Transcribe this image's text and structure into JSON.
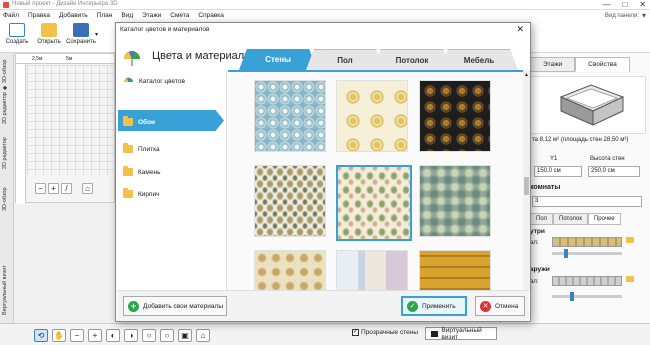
{
  "window": {
    "title": "Новый проект - Дизайн Интерьера 3D",
    "controls": [
      "—",
      "□",
      "✕"
    ]
  },
  "menu": {
    "items": [
      "Файл",
      "Правка",
      "Добавить",
      "План",
      "Вид",
      "Этажи",
      "Смета",
      "Справка"
    ],
    "view_panel_label": "Вид панели:"
  },
  "toolbar": {
    "create": "Создать",
    "open": "Открыть",
    "save": "Сохранить"
  },
  "left_tabs": [
    "2D редактор ◆ 3D-обзор",
    "2D редактор",
    "3D-обзор",
    "Виртуальный визит"
  ],
  "plan": {
    "ruler_marks": [
      "2,5м",
      "5м"
    ]
  },
  "bottom": {
    "transparent_walls": "Прозрачные стены",
    "virtual_visit": "Виртуальный визит"
  },
  "right_panel": {
    "tabs": [
      "Этажи",
      "Свойства"
    ],
    "area_text": "та 8,12 м²  (площадь стен 28,50 м²)",
    "fields": [
      {
        "label": "Y1",
        "value": "150,0 см"
      },
      {
        "label": "Высота стен",
        "value": "250,0 см"
      }
    ],
    "section_header": "комнаты",
    "room_value": "3",
    "subtabs": [
      "Пол",
      "Потолок",
      "Прочее"
    ],
    "inside_label": "утри",
    "outside_label": "аружи",
    "row_label_1": "ал:",
    "row_label_2": "ал:"
  },
  "dialog": {
    "title": "Каталог цветов и материалов",
    "close": "✕",
    "header_title": "Цвета и материалы",
    "tabs": [
      "Стены",
      "Пол",
      "Потолок",
      "Мебель"
    ],
    "side_items": [
      "Каталог цветов",
      "Обои",
      "Плитка",
      "Камень",
      "Кирпич"
    ],
    "add_button": "Добавить свои материалы",
    "apply_button": "Применить",
    "cancel_button": "Отмена"
  },
  "colors": {
    "accent": "#3aa0d8",
    "ok_green": "#2ca64a",
    "cancel_red": "#dd3333",
    "folder": "#f1c14a"
  }
}
